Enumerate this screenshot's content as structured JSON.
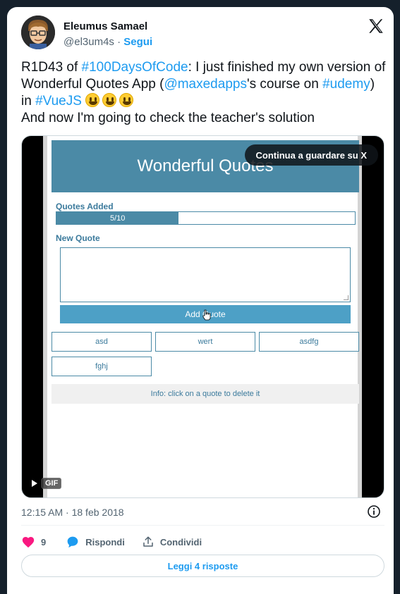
{
  "author": {
    "name": "Eleumus Samael",
    "handle": "@el3um4s",
    "separator": " · ",
    "follow_label": "Segui"
  },
  "tweet": {
    "p1": "R1D43 of ",
    "tag1": "#100DaysOfCode",
    "p2": ": I just finished my own version of Wonderful Quotes App (",
    "mention": "@maxedapps",
    "p3": "'s course on ",
    "tag2": "#udemy",
    "p4": ") in ",
    "tag3": "#VueJS",
    "line2": "And now I'm going to check the teacher's solution"
  },
  "media": {
    "overlay_label": "Continua a guardare su X",
    "gif_label": "GIF",
    "app": {
      "title": "Wonderful Quotes",
      "quotes_added_label": "Quotes Added",
      "progress_text": "5/10",
      "progress_fraction": 0.41,
      "new_quote_label": "New Quote",
      "textarea_value": "",
      "add_button": "Add Quote",
      "quotes": [
        "asd",
        "wert",
        "asdfg",
        "fghj"
      ],
      "info": "Info: click on a quote to delete it"
    }
  },
  "timestamp": "12:15 AM · 18 feb 2018",
  "actions": {
    "likes": "9",
    "reply_label": "Rispondi",
    "share_label": "Condividi"
  },
  "read_replies": "Leggi 4 risposte",
  "colors": {
    "background": "#15202b",
    "accent": "#1d9bf0",
    "like": "#f91880",
    "app_header": "#4b8aa6"
  }
}
